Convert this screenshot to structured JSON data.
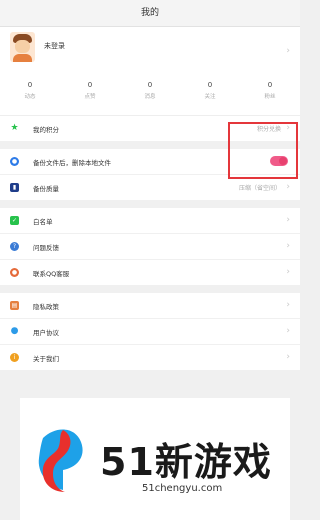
{
  "header": {
    "title": "我的"
  },
  "profile": {
    "name": "未登录"
  },
  "stats": [
    {
      "value": "0",
      "label": "动态"
    },
    {
      "value": "0",
      "label": "点赞"
    },
    {
      "value": "0",
      "label": "消息"
    },
    {
      "value": "0",
      "label": "关注"
    },
    {
      "value": "0",
      "label": "粉丝"
    }
  ],
  "points": {
    "label": "我的积分",
    "action": "积分兑换"
  },
  "backup": {
    "delete_label": "备份文件后，删除本地文件",
    "delete_enabled": true,
    "quality_label": "备份质量",
    "quality_value": "压缩（省空间）"
  },
  "menu1": [
    {
      "label": "白名单",
      "icon": "check-icon",
      "color": "#27c24c"
    },
    {
      "label": "问题反馈",
      "icon": "question-icon",
      "color": "#3a7bd5"
    },
    {
      "label": "联系QQ客服",
      "icon": "qq-icon",
      "color": "#e56a3a"
    }
  ],
  "menu2": [
    {
      "label": "隐私政策",
      "icon": "document-icon",
      "color": "#e5803f"
    },
    {
      "label": "用户协议",
      "icon": "user-icon",
      "color": "#2d9be8"
    },
    {
      "label": "关于我们",
      "icon": "info-icon",
      "color": "#f0a020"
    }
  ],
  "watermark": {
    "brand": "51新游戏",
    "domain": "51chengyu.com"
  },
  "colors": {
    "toggle_on": "#f05b89",
    "highlight": "#e4363b"
  }
}
